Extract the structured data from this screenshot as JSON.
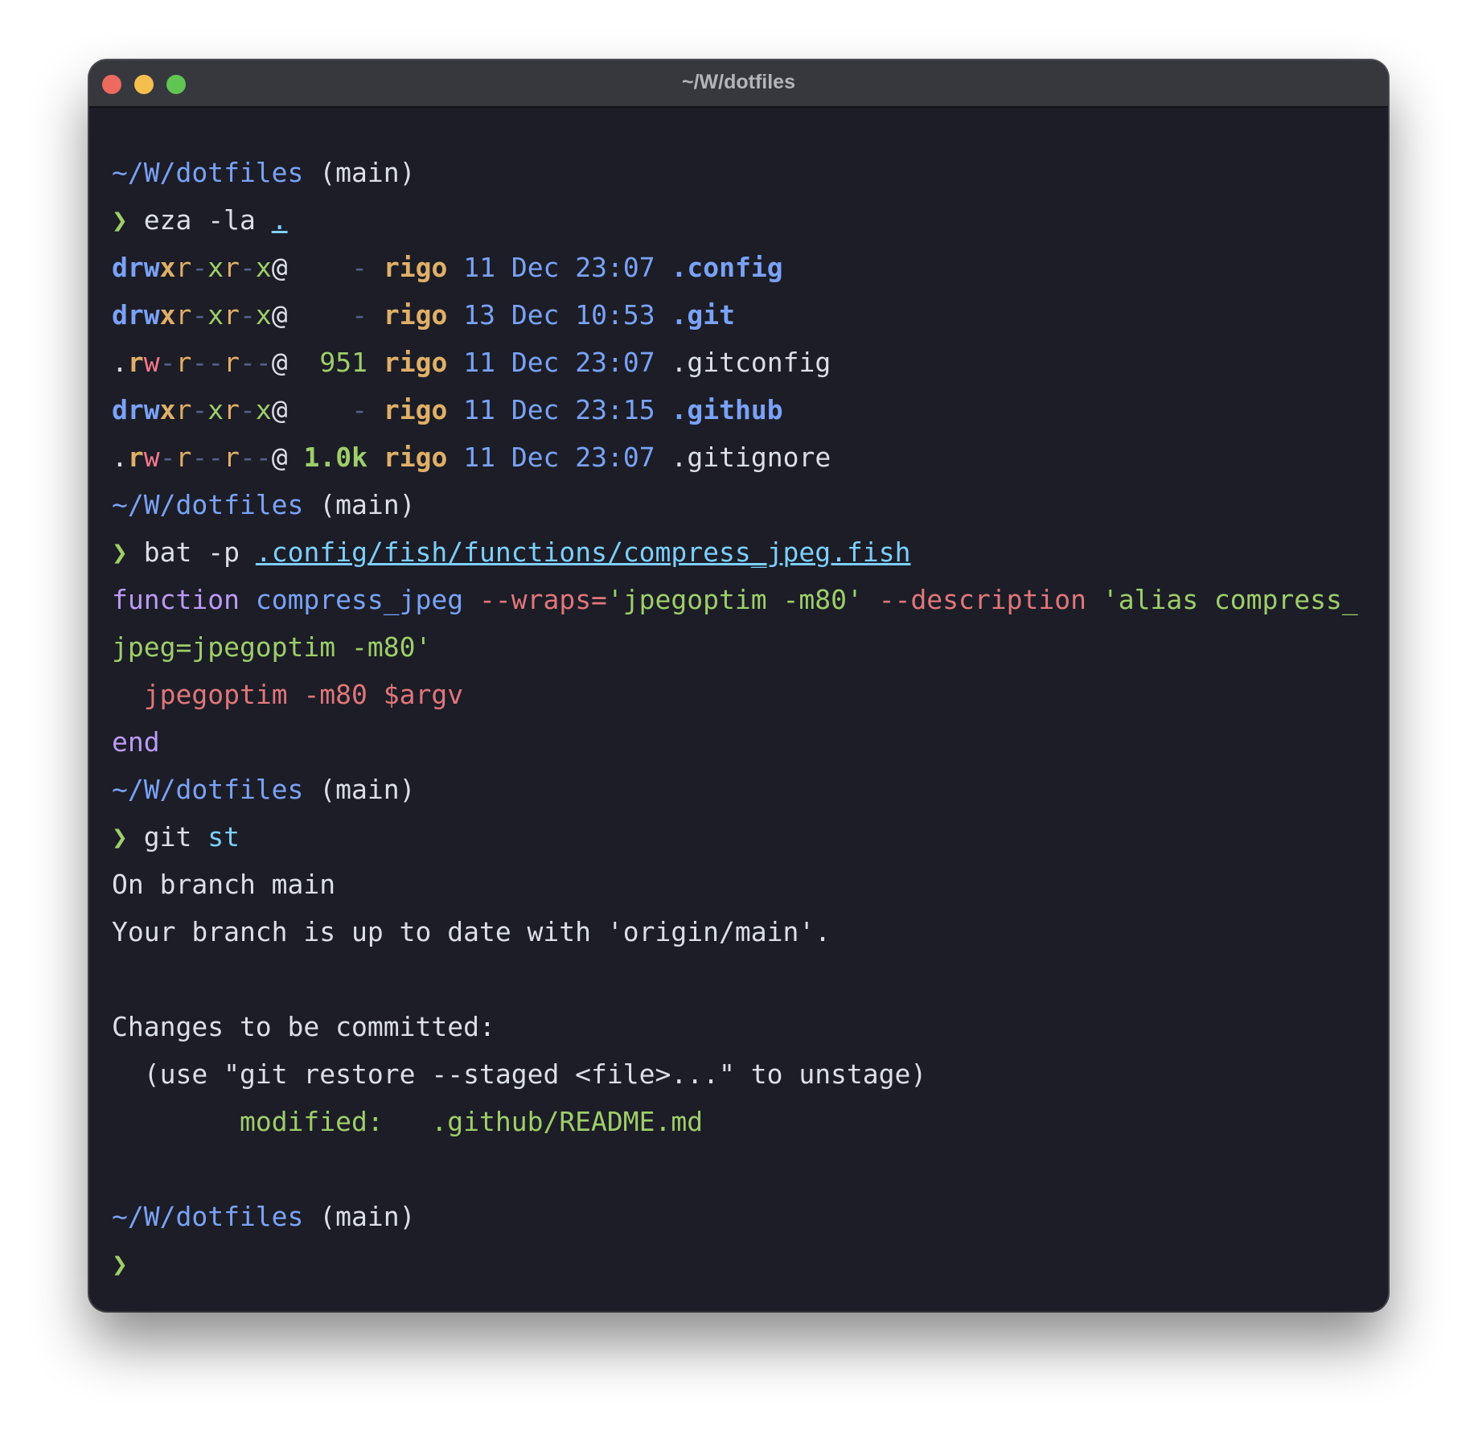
{
  "window": {
    "title": "~/W/dotfiles"
  },
  "prompt": {
    "path": "~/W/dotfiles",
    "branch": "(main)",
    "symbol": "❯"
  },
  "commands": {
    "eza": {
      "cmd": "eza",
      "args": "-la",
      "target": "."
    },
    "bat": {
      "cmd": "bat",
      "args": "-p",
      "target": ".config/fish/functions/compress_jpeg.fish"
    },
    "git": {
      "cmd": "git",
      "args": "st"
    }
  },
  "listing": [
    {
      "type": "d",
      "perms": [
        "r",
        "w",
        "x",
        "r",
        "-",
        "x",
        "r",
        "-",
        "x"
      ],
      "xattr": "@",
      "size": "-",
      "user": "rigo",
      "date": "11 Dec 23:07",
      "name": ".config",
      "dir": true
    },
    {
      "type": "d",
      "perms": [
        "r",
        "w",
        "x",
        "r",
        "-",
        "x",
        "r",
        "-",
        "x"
      ],
      "xattr": "@",
      "size": "-",
      "user": "rigo",
      "date": "13 Dec 10:53",
      "name": ".git",
      "dir": true
    },
    {
      "type": ".",
      "perms": [
        "r",
        "w",
        "-",
        "r",
        "-",
        "-",
        "r",
        "-",
        "-"
      ],
      "xattr": "@",
      "size": "951",
      "user": "rigo",
      "date": "11 Dec 23:07",
      "name": ".gitconfig",
      "dir": false
    },
    {
      "type": "d",
      "perms": [
        "r",
        "w",
        "x",
        "r",
        "-",
        "x",
        "r",
        "-",
        "x"
      ],
      "xattr": "@",
      "size": "-",
      "user": "rigo",
      "date": "11 Dec 23:15",
      "name": ".github",
      "dir": true
    },
    {
      "type": ".",
      "perms": [
        "r",
        "w",
        "-",
        "r",
        "-",
        "-",
        "r",
        "-",
        "-"
      ],
      "xattr": "@",
      "size": "1.0k",
      "user": "rigo",
      "date": "11 Dec 23:07",
      "name": ".gitignore",
      "dir": false
    }
  ],
  "fish_function": {
    "keyword": "function",
    "name": "compress_jpeg",
    "wraps_flag": "--wraps=",
    "wraps_value": "'jpegoptim -m80'",
    "desc_flag": "--description",
    "desc_value_line1": "'alias compress_",
    "desc_value_line2": "jpeg=jpegoptim -m80'",
    "body_cmd": "jpegoptim",
    "body_flag": "-m80",
    "body_var": "$argv",
    "end": "end"
  },
  "git_status": {
    "line1": "On branch main",
    "line2": "Your branch is up to date with 'origin/main'.",
    "changes_header": "Changes to be committed:",
    "hint": "(use \"git restore --staged <file>...\" to unstage)",
    "modified_label": "modified:",
    "modified_file": ".github/README.md"
  }
}
